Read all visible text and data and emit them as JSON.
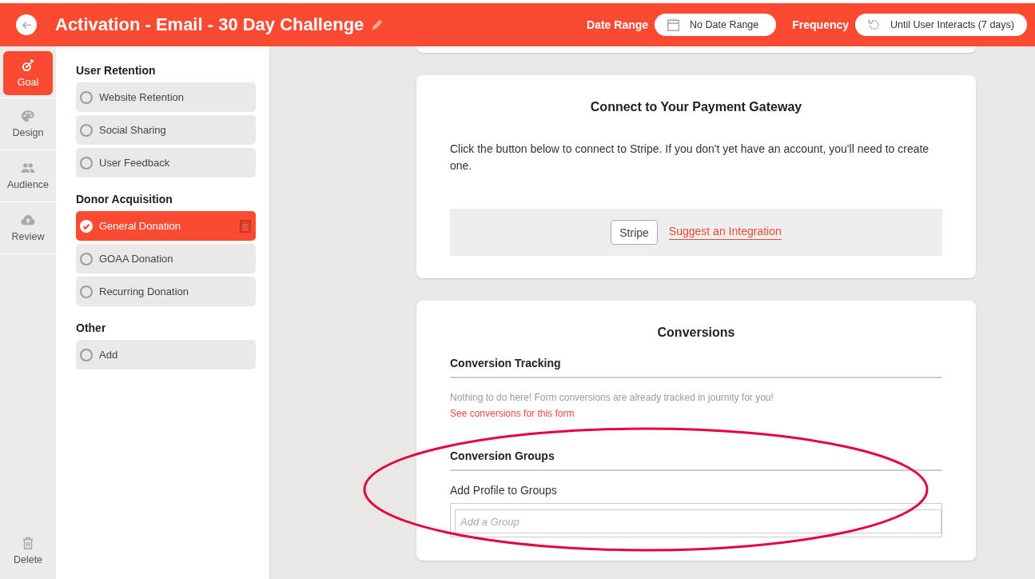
{
  "header": {
    "title": "Activation - Email - 30 Day Challenge",
    "date_range": {
      "label": "Date Range",
      "value": "No Date Range"
    },
    "frequency": {
      "label": "Frequency",
      "value": "Until User Interacts (7 days)"
    }
  },
  "nav": {
    "items": [
      {
        "label": "Goal",
        "selected": true
      },
      {
        "label": "Design",
        "selected": false
      },
      {
        "label": "Audience",
        "selected": false
      },
      {
        "label": "Review",
        "selected": false
      }
    ],
    "footer_action": "Delete"
  },
  "goal_groups": [
    {
      "heading": "User Retention",
      "items": [
        {
          "label": "Website Retention",
          "selected": false
        },
        {
          "label": "Social Sharing",
          "selected": false
        },
        {
          "label": "User Feedback",
          "selected": false
        }
      ]
    },
    {
      "heading": "Donor Acquisition",
      "items": [
        {
          "label": "General Donation",
          "selected": true
        },
        {
          "label": "GOAA Donation",
          "selected": false
        },
        {
          "label": "Recurring Donation",
          "selected": false
        }
      ]
    },
    {
      "heading": "Other",
      "items": [
        {
          "label": "Add",
          "selected": false
        }
      ]
    }
  ],
  "payment_card": {
    "title": "Connect to Your Payment Gateway",
    "text": "Click the button below to connect to Stripe. If you don't yet have an account, you'll need to create one.",
    "button": "Stripe",
    "link": "Suggest an Integration"
  },
  "conversions_card": {
    "title": "Conversions",
    "tracking": {
      "heading": "Conversion Tracking",
      "note": "Nothing to do here! Form conversions are already tracked in journity for you!",
      "link": "See conversions for this form"
    },
    "groups": {
      "heading": "Conversion Groups",
      "label": "Add Profile to Groups",
      "placeholder": "Add a Group"
    }
  },
  "annotation": {
    "kind": "ellipse"
  }
}
